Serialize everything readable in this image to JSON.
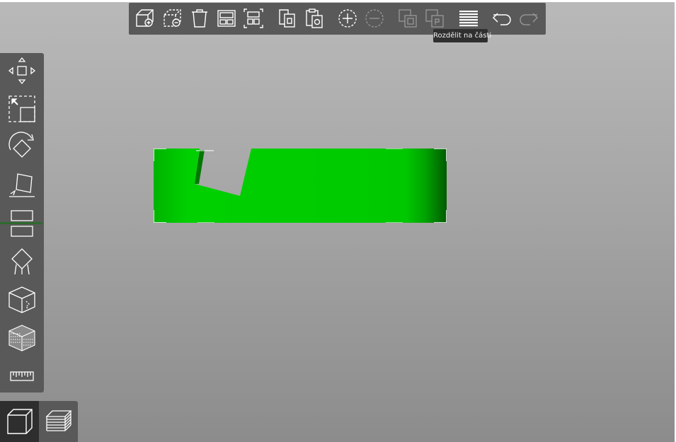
{
  "top_toolbar": {
    "buttons": [
      {
        "name": "add-object",
        "icon": "cube-plus-icon",
        "enabled": true
      },
      {
        "name": "remove-object",
        "icon": "cube-minus-icon",
        "enabled": true
      },
      {
        "name": "delete",
        "icon": "trash-icon",
        "enabled": true
      },
      {
        "name": "arrange",
        "icon": "arrange-icon",
        "enabled": true
      },
      {
        "name": "arrange-selection",
        "icon": "arrange-selection-icon",
        "enabled": true
      },
      {
        "name": "copy",
        "icon": "copy-icon",
        "enabled": true
      },
      {
        "name": "paste",
        "icon": "paste-icon",
        "enabled": true
      },
      {
        "name": "add-instance",
        "icon": "plus-circle-icon",
        "enabled": true
      },
      {
        "name": "remove-instance",
        "icon": "minus-circle-icon",
        "enabled": false
      },
      {
        "name": "split-to-objects",
        "icon": "split-objects-icon",
        "enabled": false
      },
      {
        "name": "split-to-parts",
        "icon": "split-parts-icon",
        "enabled": false
      },
      {
        "name": "layers-editing",
        "icon": "layers-icon",
        "enabled": true
      },
      {
        "name": "undo",
        "icon": "undo-icon",
        "enabled": true
      },
      {
        "name": "redo",
        "icon": "redo-icon",
        "enabled": false
      }
    ],
    "tooltip": "Rozdělit na části"
  },
  "left_toolbar": {
    "tools": [
      {
        "name": "move",
        "icon": "move-icon"
      },
      {
        "name": "scale",
        "icon": "scale-icon"
      },
      {
        "name": "rotate",
        "icon": "rotate-icon"
      },
      {
        "name": "place-on-face",
        "icon": "place-on-face-icon"
      },
      {
        "name": "cut",
        "icon": "cut-icon"
      },
      {
        "name": "supports",
        "icon": "support-points-icon"
      },
      {
        "name": "seam",
        "icon": "seam-painting-icon"
      },
      {
        "name": "mmu-painting",
        "icon": "mmu-painting-icon"
      },
      {
        "name": "measure",
        "icon": "ruler-icon"
      }
    ]
  },
  "view_toggle": {
    "items": [
      {
        "name": "3d-view",
        "icon": "3d-view-cube-icon",
        "active": true
      },
      {
        "name": "preview",
        "icon": "preview-layers-icon",
        "active": false
      }
    ]
  },
  "colors": {
    "toolbar": "#595959",
    "model": "#00c800",
    "tooltip_bg": "#2f2f2f"
  }
}
